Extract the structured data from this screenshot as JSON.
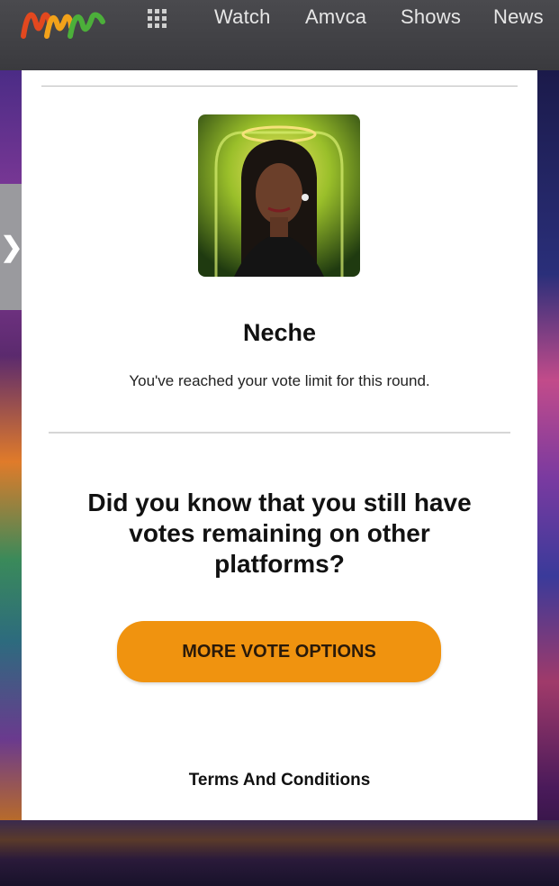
{
  "header": {
    "nav": [
      "Watch",
      "Amvca",
      "Shows",
      "News"
    ]
  },
  "contestant": {
    "name": "Neche",
    "status_message": "You've reached your vote limit for this round."
  },
  "promo": {
    "question": "Did you know that you still have votes remaining on other platforms?",
    "button_label": "MORE VOTE OPTIONS"
  },
  "footer": {
    "terms_link": "Terms And Conditions"
  },
  "colors": {
    "accent_button": "#f0930f",
    "header_bg": "#3a3a3e"
  },
  "icons": [
    "africa-magic-logo",
    "apps-grid-icon",
    "chevron-right-icon"
  ]
}
